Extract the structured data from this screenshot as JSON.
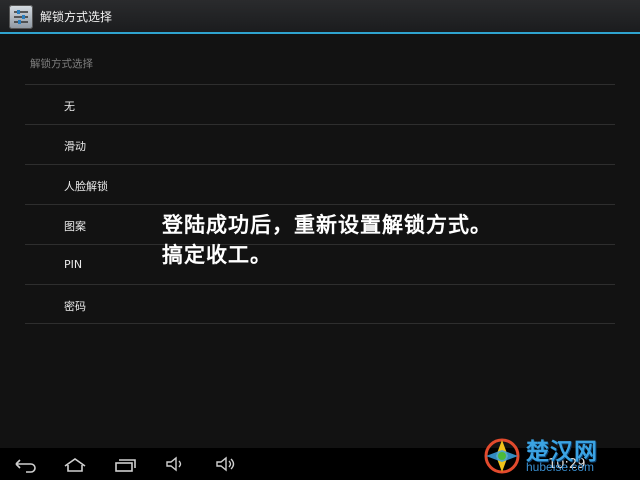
{
  "action_bar": {
    "title": "解锁方式选择"
  },
  "section": {
    "header": "解锁方式选择"
  },
  "options": [
    {
      "label": "无"
    },
    {
      "label": "滑动"
    },
    {
      "label": "人脸解锁"
    },
    {
      "label": "图案"
    },
    {
      "label": "PIN"
    },
    {
      "label": "密码"
    }
  ],
  "overlay": {
    "line1": "登陆成功后，重新设置解锁方式。",
    "line2": "搞定收工。"
  },
  "status": {
    "clock": "10:29"
  },
  "watermark": {
    "brand": "楚汉网",
    "url": "hubeise.com"
  },
  "nav_icons": [
    "back-icon",
    "home-icon",
    "recent-apps-icon",
    "volume-down-icon",
    "volume-up-icon"
  ],
  "colors": {
    "accent": "#2fa3cf",
    "background": "#121212",
    "navbar": "#000000"
  }
}
